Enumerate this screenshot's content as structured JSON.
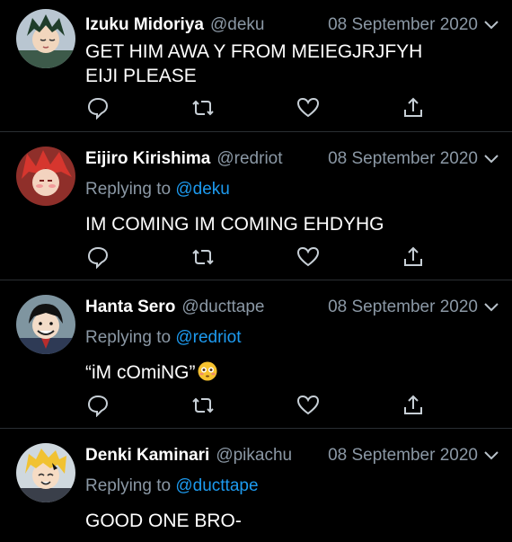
{
  "tweets": [
    {
      "name": "Izuku Midoriya",
      "handle": "@deku",
      "date": "08 September 2020",
      "replying_prefix": "",
      "replying_to": "",
      "text": "GET HIM AWA Y FROM MEIEGJRJFYH EIJI PLEASE"
    },
    {
      "name": "Eijiro Kirishima",
      "handle": "@redriot",
      "date": "08 September 2020",
      "replying_prefix": "Replying to",
      "replying_to": "@deku",
      "text": "IM COMING IM COMING EHDYHG"
    },
    {
      "name": "Hanta Sero",
      "handle": "@ducttape",
      "date": "08 September 2020",
      "replying_prefix": "Replying to",
      "replying_to": "@redriot",
      "text": "“iM cOmiNG”"
    },
    {
      "name": "Denki Kaminari",
      "handle": "@pikachu",
      "date": "08 September 2020",
      "replying_prefix": "Replying to",
      "replying_to": "@ducttape",
      "text": "GOOD ONE BRO-"
    }
  ],
  "icons": {
    "reply": "reply-icon",
    "retweet": "retweet-icon",
    "like": "like-icon",
    "share": "share-icon",
    "menu": "chevron-down-icon",
    "emoji": "flushed-face-emoji"
  },
  "colors": {
    "background": "#000000",
    "text": "#ffffff",
    "secondary": "#8b98a5",
    "link": "#1d9bf0",
    "divider": "#2a2f33"
  }
}
